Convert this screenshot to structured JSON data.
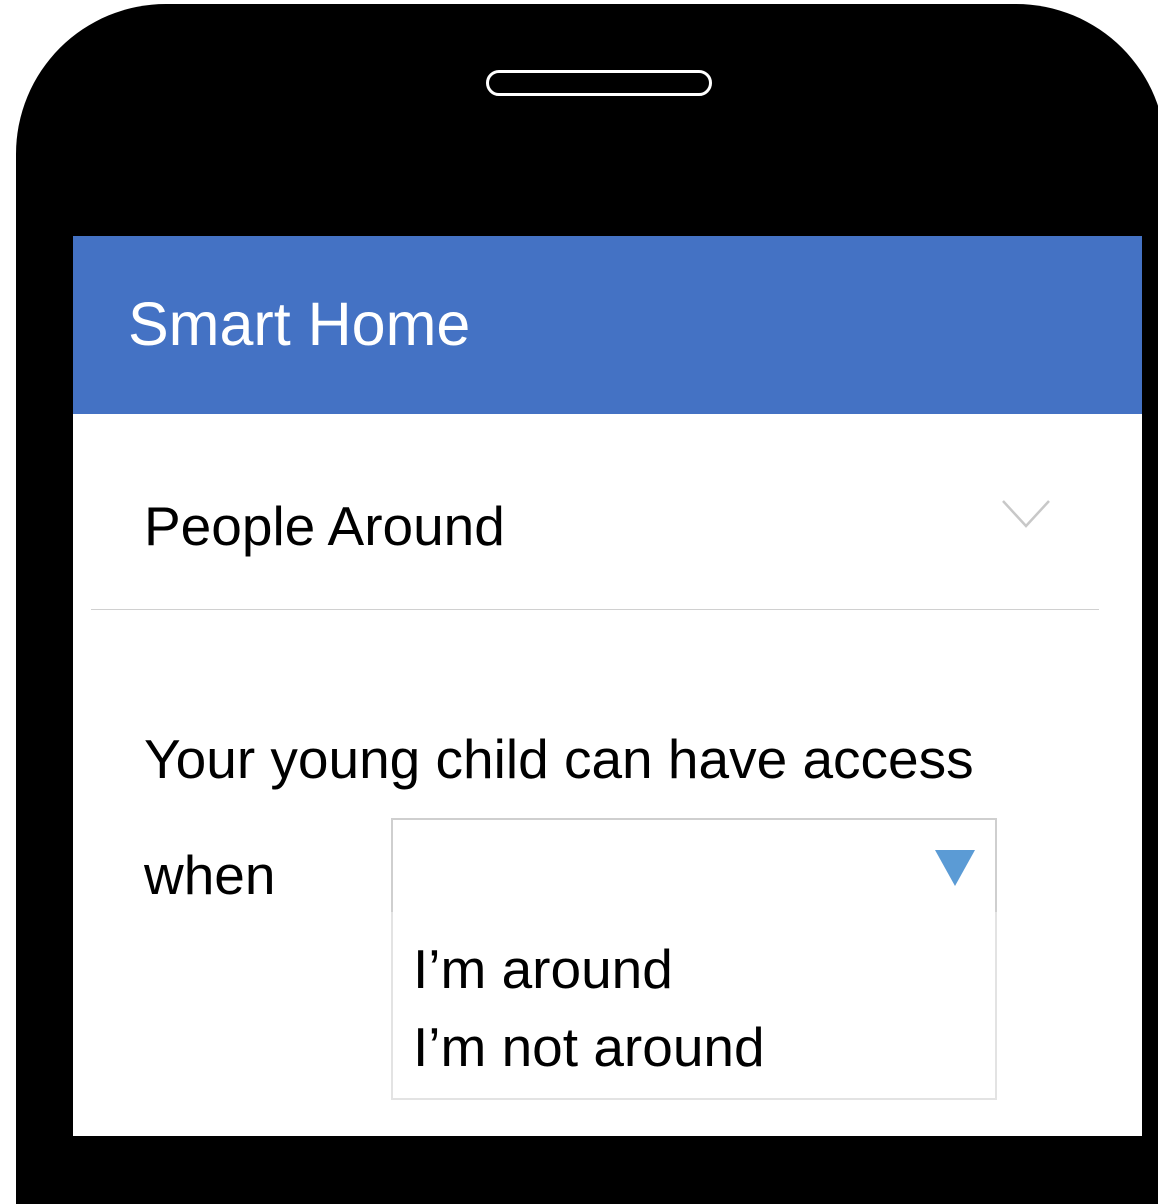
{
  "app": {
    "title": "Smart Home"
  },
  "section": {
    "title": "People Around",
    "toggle_icon": "chevron-down-icon"
  },
  "rule": {
    "sentence": "Your young child can have access",
    "when_label": "when",
    "select": {
      "value": "",
      "arrow_icon": "triangle-down-icon",
      "arrow_color": "#5b9bd5",
      "options": [
        "I’m around",
        "I’m not around"
      ]
    }
  },
  "colors": {
    "appbar": "#4472c4",
    "phone_frame": "#000000"
  }
}
